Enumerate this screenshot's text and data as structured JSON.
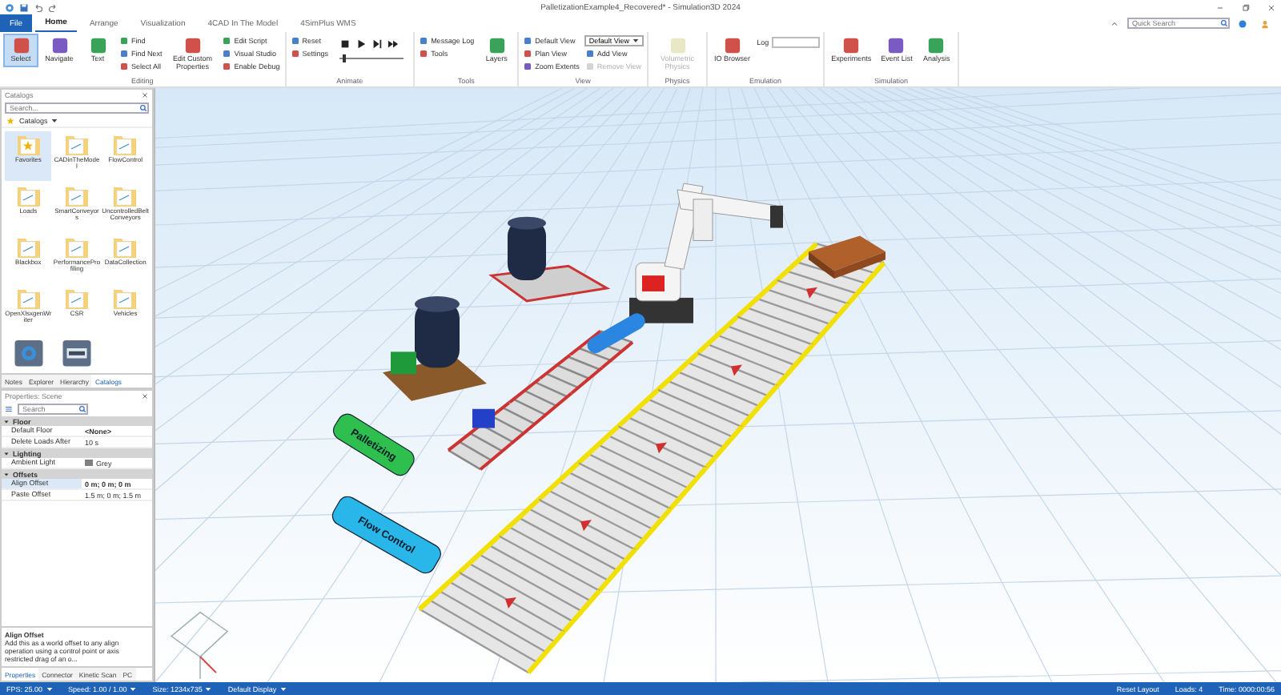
{
  "window": {
    "title": "PalletizationExample4_Recovered* - Simulation3D 2024"
  },
  "ribbon_tabs": [
    {
      "label": "File",
      "selected": false,
      "kind": "file"
    },
    {
      "label": "Home",
      "selected": true,
      "kind": "tab"
    },
    {
      "label": "Arrange",
      "selected": false,
      "kind": "tab"
    },
    {
      "label": "Visualization",
      "selected": false,
      "kind": "tab"
    },
    {
      "label": "4CAD In The Model",
      "selected": false,
      "kind": "tab"
    },
    {
      "label": "4SimPlus WMS",
      "selected": false,
      "kind": "tab"
    }
  ],
  "quick_search": {
    "placeholder": "Quick Search"
  },
  "ribbon_groups": [
    {
      "label": "Editing",
      "items": [
        {
          "label": "Select",
          "kind": "large",
          "selected": true,
          "disabled": false
        },
        {
          "label": "Navigate",
          "kind": "large",
          "selected": false,
          "disabled": false
        },
        {
          "label": "Text",
          "kind": "large",
          "selected": false,
          "disabled": false
        },
        {
          "label": "Find",
          "kind": "small",
          "selected": false,
          "disabled": false
        },
        {
          "label": "Find Next",
          "kind": "small",
          "selected": false,
          "disabled": false
        },
        {
          "label": "Select All",
          "kind": "small",
          "selected": false,
          "disabled": false
        },
        {
          "label": "Edit Custom Properties",
          "kind": "large",
          "selected": false,
          "disabled": false
        },
        {
          "label": "Edit Script",
          "kind": "small",
          "selected": false,
          "disabled": false
        },
        {
          "label": "Visual Studio",
          "kind": "small",
          "selected": false,
          "disabled": false
        },
        {
          "label": "Enable Debug",
          "kind": "small",
          "selected": false,
          "disabled": false
        }
      ]
    },
    {
      "label": "Animate",
      "items": [
        {
          "label": "Reset",
          "kind": "small",
          "selected": false,
          "disabled": false
        },
        {
          "label": "Settings",
          "kind": "small",
          "selected": false,
          "disabled": false
        },
        {
          "kind": "player",
          "level": 0.04
        }
      ]
    },
    {
      "label": "Tools",
      "items": [
        {
          "label": "Message Log",
          "kind": "small",
          "selected": false,
          "disabled": false
        },
        {
          "label": "Tools",
          "kind": "small",
          "selected": false,
          "disabled": false
        },
        {
          "label": "Layers",
          "kind": "large",
          "selected": false,
          "disabled": false
        }
      ]
    },
    {
      "label": "View",
      "items": [
        {
          "label": "Default View",
          "kind": "small",
          "selected": false,
          "disabled": false
        },
        {
          "label": "Plan View",
          "kind": "small",
          "selected": false,
          "disabled": false
        },
        {
          "label": "Zoom Extents",
          "kind": "small",
          "selected": false,
          "disabled": false
        },
        {
          "label": "Default View",
          "kind": "dropdown"
        },
        {
          "label": "Add View",
          "kind": "small",
          "selected": false,
          "disabled": false
        },
        {
          "label": "Remove View",
          "kind": "small",
          "selected": false,
          "disabled": true
        }
      ]
    },
    {
      "label": "Physics",
      "items": [
        {
          "label": "Volumetric Physics",
          "kind": "large",
          "selected": false,
          "disabled": true
        }
      ]
    },
    {
      "label": "Emulation",
      "items": [
        {
          "label": "IO Browser",
          "kind": "large",
          "selected": false,
          "disabled": false
        },
        {
          "label": "Log",
          "kind": "field"
        }
      ]
    },
    {
      "label": "Simulation",
      "items": [
        {
          "label": "Experiments",
          "kind": "large",
          "selected": false,
          "disabled": false
        },
        {
          "label": "Event List",
          "kind": "large",
          "selected": false,
          "disabled": false
        },
        {
          "label": "Analysis",
          "kind": "large",
          "selected": false,
          "disabled": false
        }
      ]
    }
  ],
  "catalogs": {
    "title": "Catalogs",
    "search": {
      "placeholder": "Search..."
    },
    "breadcrumb": "Catalogs",
    "items": [
      {
        "label": "Favorites",
        "selected": true,
        "kind": "star"
      },
      {
        "label": "CADinTheModel",
        "selected": false,
        "kind": "folder"
      },
      {
        "label": "FlowControl",
        "selected": false,
        "kind": "folder"
      },
      {
        "label": "Loads",
        "selected": false,
        "kind": "folder"
      },
      {
        "label": "SmartConveyors",
        "selected": false,
        "kind": "folder"
      },
      {
        "label": "UncontrolledBeltConveyors",
        "selected": false,
        "kind": "folder"
      },
      {
        "label": "Blackbox",
        "selected": false,
        "kind": "folder"
      },
      {
        "label": "PerformanceProfiling",
        "selected": false,
        "kind": "folder"
      },
      {
        "label": "DataCollection",
        "selected": false,
        "kind": "folder"
      },
      {
        "label": "OpenXlsxgenWriter",
        "selected": false,
        "kind": "folder"
      },
      {
        "label": "CSR",
        "selected": false,
        "kind": "folder"
      },
      {
        "label": "Vehicles",
        "selected": false,
        "kind": "folder"
      },
      {
        "selected": false,
        "kind": "gear"
      },
      {
        "selected": false,
        "kind": "device"
      }
    ],
    "tabs": [
      {
        "label": "Notes",
        "selected": false
      },
      {
        "label": "Explorer",
        "selected": false
      },
      {
        "label": "Hierarchy",
        "selected": false
      },
      {
        "label": "Catalogs",
        "selected": true
      }
    ]
  },
  "properties": {
    "title": "Properties: Scene",
    "search": {
      "placeholder": "Search"
    },
    "categories": [
      {
        "name": "Floor",
        "expanded": true,
        "rows": [
          {
            "name": "Default Floor",
            "value": "<None>",
            "selected": false
          },
          {
            "name": "Delete Loads After",
            "value": "10 s",
            "selected": false
          }
        ]
      },
      {
        "name": "Lighting",
        "expanded": true,
        "rows": [
          {
            "name": "Ambient Light",
            "value": "Grey",
            "selected": false,
            "color": "#808080"
          }
        ]
      },
      {
        "name": "Offsets",
        "expanded": true,
        "rows": [
          {
            "name": "Align Offset",
            "value": "0 m; 0 m; 0 m",
            "selected": true
          },
          {
            "name": "Paste Offset",
            "value": "1.5 m; 0 m; 1.5 m",
            "selected": false
          }
        ]
      }
    ],
    "description": {
      "title": "Align Offset",
      "text": "Add this as a world offset to any align operation using a control point or axis restricted drag of an o..."
    },
    "tabs": [
      {
        "label": "Properties",
        "selected": true
      },
      {
        "label": "Connector",
        "selected": false
      },
      {
        "label": "Kinetic Scan",
        "selected": false
      },
      {
        "label": "PC",
        "selected": false
      }
    ]
  },
  "scene": {
    "signs": [
      {
        "text": "Palletizing",
        "color": "#2fbf4f"
      },
      {
        "text": "Flow Control",
        "color": "#29b6e8"
      }
    ]
  },
  "status_bar": {
    "left": [
      "FPS: 25.00",
      "Speed: 1.00 / 1.00",
      "Size: 1234x735",
      "Default Display"
    ],
    "right": [
      "Reset Layout",
      "Loads: 4",
      "Time: 0000:00:56"
    ]
  }
}
